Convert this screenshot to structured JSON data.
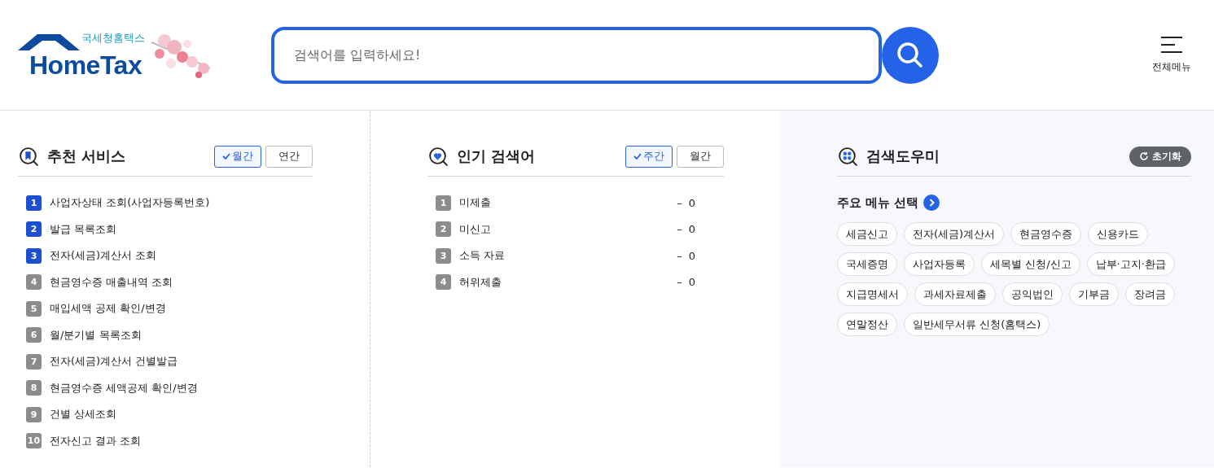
{
  "header": {
    "logo": {
      "subtitle": "국세청홈택스",
      "name": "HomeTax"
    },
    "search": {
      "placeholder": "검색어를 입력하세요!"
    },
    "menu_label": "전체메뉴"
  },
  "recommended": {
    "title": "추천 서비스",
    "periods": [
      {
        "label": "월간",
        "selected": true
      },
      {
        "label": "연간",
        "selected": false
      }
    ],
    "items": [
      {
        "rank": "1",
        "label": "사업자상태 조회(사업자등록번호)",
        "highlighted": true
      },
      {
        "rank": "2",
        "label": "발급 목록조회",
        "highlighted": true
      },
      {
        "rank": "3",
        "label": "전자(세금)계산서 조회",
        "highlighted": true
      },
      {
        "rank": "4",
        "label": "현금영수증 매출내역 조회",
        "highlighted": false
      },
      {
        "rank": "5",
        "label": "매입세액 공제 확인/변경",
        "highlighted": false
      },
      {
        "rank": "6",
        "label": "월/분기별 목록조회",
        "highlighted": false
      },
      {
        "rank": "7",
        "label": "전자(세금)계산서 건별발급",
        "highlighted": false
      },
      {
        "rank": "8",
        "label": "현금영수증 세액공제 확인/변경",
        "highlighted": false
      },
      {
        "rank": "9",
        "label": "건별 상세조회",
        "highlighted": false
      },
      {
        "rank": "10",
        "label": "전자신고 결과 조회",
        "highlighted": false
      }
    ]
  },
  "popular": {
    "title": "인기 검색어",
    "periods": [
      {
        "label": "주간",
        "selected": true
      },
      {
        "label": "월간",
        "selected": false
      }
    ],
    "items": [
      {
        "rank": "1",
        "label": "미제출",
        "highlighted": false,
        "trend": "–",
        "change": "0"
      },
      {
        "rank": "2",
        "label": "미신고",
        "highlighted": false,
        "trend": "–",
        "change": "0"
      },
      {
        "rank": "3",
        "label": "소득 자료",
        "highlighted": false,
        "trend": "–",
        "change": "0"
      },
      {
        "rank": "4",
        "label": "허위제출",
        "highlighted": false,
        "trend": "–",
        "change": "0"
      }
    ]
  },
  "helper": {
    "title": "검색도우미",
    "reset": "초기화",
    "subtitle": "주요 메뉴 선택",
    "chips": [
      "세금신고",
      "전자(세금)계산서",
      "현금영수증",
      "신용카드",
      "국세증명",
      "사업자등록",
      "세목별 신청/신고",
      "납부·고지·환급",
      "지급명세서",
      "과세자료제출",
      "공익법인",
      "기부금",
      "장려금",
      "연말정산",
      "일반세무서류 신청(홈택스)"
    ]
  }
}
